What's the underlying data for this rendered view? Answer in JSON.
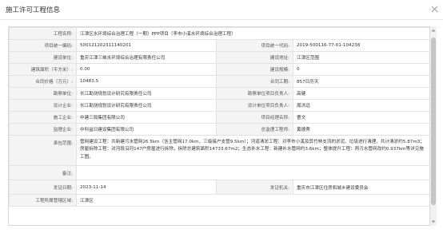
{
  "dialog": {
    "title": "施工许可工程信息",
    "close_icon": "close-icon"
  },
  "rows": [
    {
      "type": "full",
      "label": "工程名称:",
      "value": "江津区水环境综合治理工程（一期）PPP项目（李市小溪水环境综合治理工程）"
    },
    {
      "type": "pair",
      "l1": "项目统一编码:",
      "v1": "500121202311140201",
      "l2": "项目统一代码:",
      "v2": "2019-500116-77-01-104238"
    },
    {
      "type": "pair",
      "l1": "建设单位:",
      "v1": "重庆江津三峡水环境综合治理有限责任公司",
      "l2": "建设地址:",
      "v2": "江津区范围"
    },
    {
      "type": "pair",
      "l1": "建筑面积（平方米）:",
      "v1": "0.00",
      "l2": "建设规模:",
      "v2": "0"
    },
    {
      "type": "pair",
      "l1": "合同价格（万元）:",
      "v1": "10483.5",
      "l2": "合同工期:",
      "v2": "857日历天"
    },
    {
      "type": "pair",
      "l1": "勘察单位:",
      "v1": "长江勘测规划设计研究有限责任公司",
      "l2": "勘察单位项目负责人:",
      "v2": "高健"
    },
    {
      "type": "pair",
      "l1": "设计企业:",
      "v1": "长江勘测规划设计研究有限责任公司",
      "l2": "设计单位项目负责人:",
      "v2": "周洪远"
    },
    {
      "type": "pair",
      "l1": "施工企业:",
      "v1": "中建三局集团有限公司",
      "l2": "项目经理名称:",
      "v2": "曹文"
    },
    {
      "type": "pair",
      "l1": "监理企业:",
      "v1": "中科益日建设集团有限公司",
      "l2": "总监理工程师:",
      "v2": "黄德秀"
    },
    {
      "type": "full-multi",
      "label": "承包范围:",
      "value": "管网建设工程：共新建污水管网26.5km（含主管网17.0km，三级接户支管9.5km）；河道清淤工程：对李市小溪及其竹林支流的淤泥、垃圾进行清理，共计清淤约5.87m3；房屋拆除工程：对河段沿河147户房屋进行拆除，拆除总建筑面积14733.67m2；生态补水工程：新建补水管网约3.6km；整体提升工程：两污水管网改约0.937km等详见施工图。"
    },
    {
      "type": "full",
      "label": "备注:",
      "value": ""
    },
    {
      "type": "pair",
      "l1": "发证日期:",
      "v1": "2023-11-14",
      "l2": "发证机关:",
      "v2": "重庆市江津区住房和城乡建设委员会"
    },
    {
      "type": "full",
      "label": "工程所属管辖区域:",
      "value": "江津区"
    }
  ]
}
